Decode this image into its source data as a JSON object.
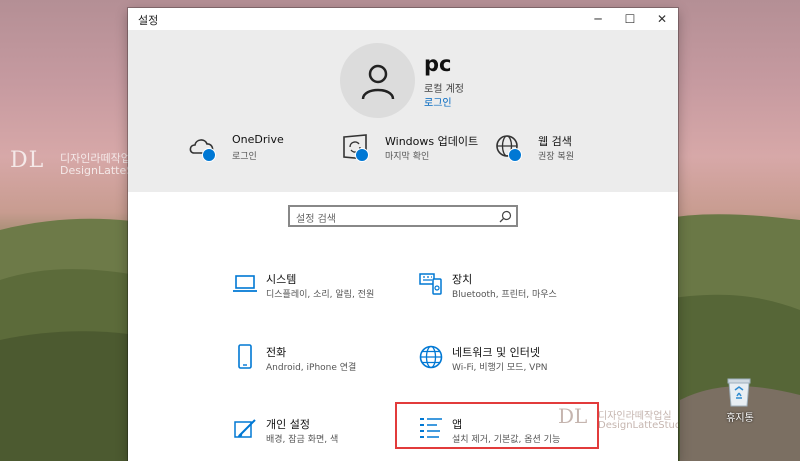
{
  "desktop": {
    "watermark_logo": "DL",
    "watermark_ko": "디자인라떼작업실",
    "watermark_en": "DesignLatteStudio",
    "recycle_bin_label": "휴지통"
  },
  "window": {
    "title": "설정",
    "controls": {
      "minimize": "─",
      "maximize": "☐",
      "close": "✕"
    }
  },
  "account": {
    "name": "pc",
    "type": "로컬 계정",
    "signin_link": "로그인"
  },
  "quick_links": [
    {
      "title": "OneDrive",
      "subtitle": "로그인",
      "icon": "cloud-icon"
    },
    {
      "title": "Windows 업데이트",
      "subtitle": "마지막 확인",
      "icon": "update-icon"
    },
    {
      "title": "웹 검색",
      "subtitle": "권장 복원",
      "icon": "globe-icon"
    }
  ],
  "search": {
    "placeholder": "설정 검색"
  },
  "categories": [
    {
      "title": "시스템",
      "subtitle": "디스플레이, 소리, 알림, 전원",
      "icon": "laptop-icon"
    },
    {
      "title": "장치",
      "subtitle": "Bluetooth, 프린터, 마우스",
      "icon": "keyboard-icon"
    },
    {
      "title": "전화",
      "subtitle": "Android, iPhone 연결",
      "icon": "phone-icon"
    },
    {
      "title": "네트워크 및 인터넷",
      "subtitle": "Wi-Fi, 비행기 모드, VPN",
      "icon": "globe-icon"
    },
    {
      "title": "개인 설정",
      "subtitle": "배경, 잠금 화면, 색",
      "icon": "paint-icon"
    },
    {
      "title": "앱",
      "subtitle": "설치 제거, 기본값, 옵션 기능",
      "icon": "apps-list-icon"
    }
  ],
  "colors": {
    "accent": "#0078d4",
    "highlight": "#e23b3b"
  }
}
